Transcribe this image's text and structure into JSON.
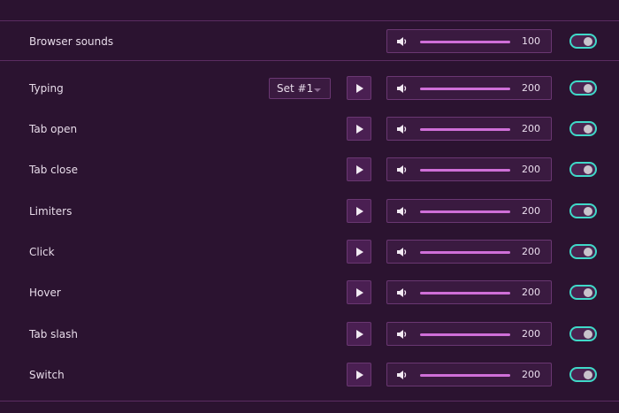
{
  "accent_color": "#cf6fd8",
  "toggle_color": "#3fd9c8",
  "browser_sounds": {
    "label": "Browser sounds",
    "volume": 100,
    "volume_fraction": 1.0,
    "volume_icon": "speaker-icon",
    "enabled": true
  },
  "sounds": [
    {
      "label": "Typing",
      "set_select": "Set #1",
      "volume": 200,
      "volume_fraction": 1.0,
      "enabled": true
    },
    {
      "label": "Tab open",
      "volume": 200,
      "volume_fraction": 1.0,
      "enabled": true
    },
    {
      "label": "Tab close",
      "volume": 200,
      "volume_fraction": 1.0,
      "enabled": true
    },
    {
      "label": "Limiters",
      "volume": 200,
      "volume_fraction": 1.0,
      "enabled": true
    },
    {
      "label": "Click",
      "volume": 200,
      "volume_fraction": 1.0,
      "enabled": true
    },
    {
      "label": "Hover",
      "volume": 200,
      "volume_fraction": 1.0,
      "enabled": true
    },
    {
      "label": "Tab slash",
      "volume": 200,
      "volume_fraction": 1.0,
      "enabled": true
    },
    {
      "label": "Switch",
      "volume": 200,
      "volume_fraction": 1.0,
      "enabled": true
    }
  ]
}
